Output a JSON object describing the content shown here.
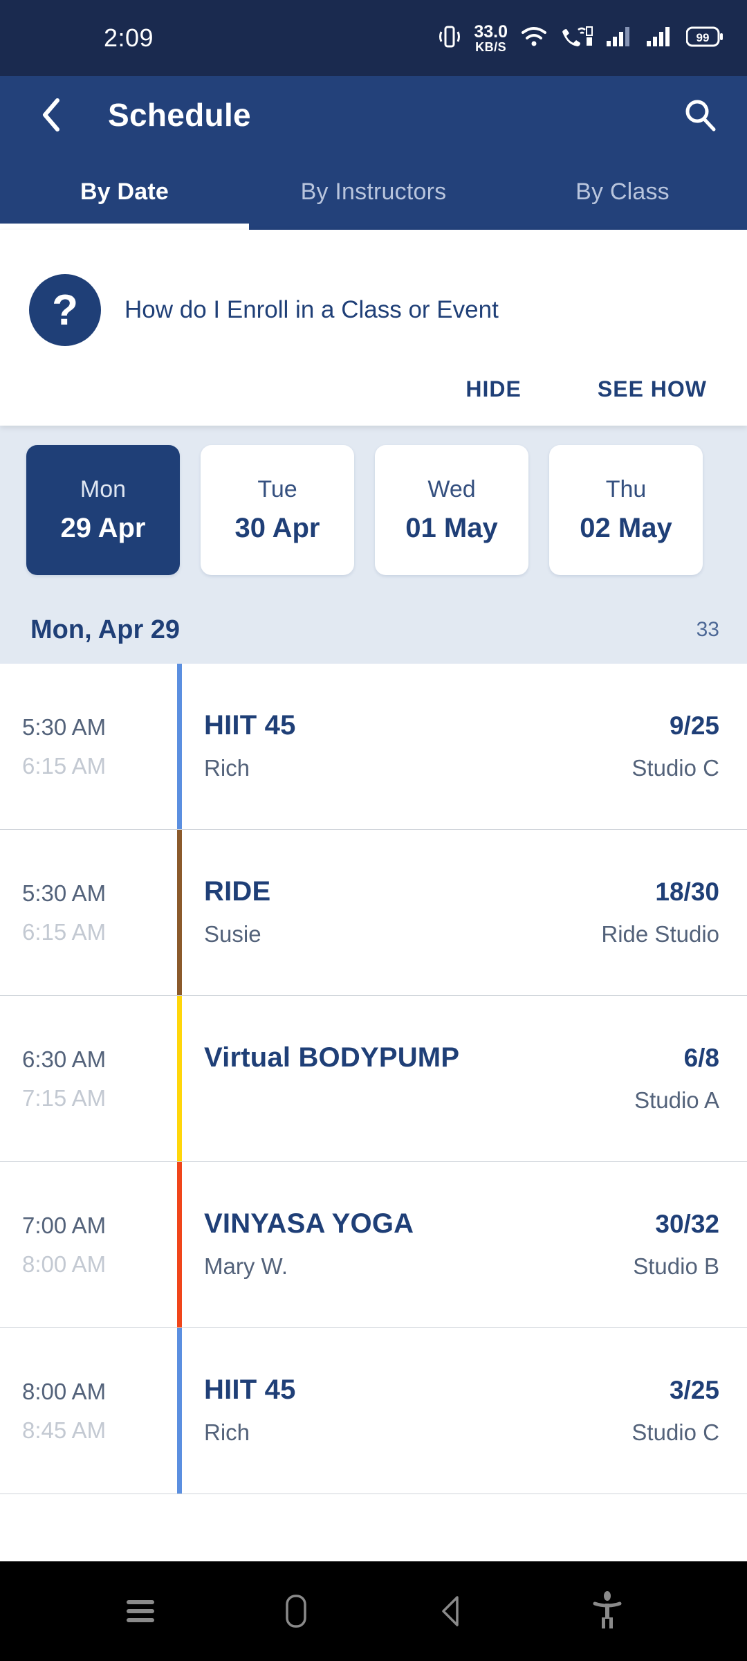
{
  "statusbar": {
    "time": "2:09",
    "net_speed_value": "33.0",
    "net_speed_unit": "KB/S",
    "battery": "99",
    "icons": [
      "vibrate-icon",
      "wifi-icon",
      "vowifi-sim2-icon",
      "signal-sim1-icon",
      "signal-sim2-icon",
      "battery-icon"
    ]
  },
  "header": {
    "title": "Schedule",
    "back_icon": "chevron-left-icon",
    "search_icon": "search-icon",
    "tabs": [
      {
        "label": "By Date",
        "active": true
      },
      {
        "label": "By Instructors",
        "active": false
      },
      {
        "label": "By Class",
        "active": false
      }
    ]
  },
  "help": {
    "icon_glyph": "?",
    "question": "How do I Enroll in a Class or Event",
    "hide_label": "HIDE",
    "see_how_label": "SEE HOW"
  },
  "dates": [
    {
      "dow": "Mon",
      "date": "29 Apr",
      "selected": true
    },
    {
      "dow": "Tue",
      "date": "30 Apr",
      "selected": false
    },
    {
      "dow": "Wed",
      "date": "01 May",
      "selected": false
    },
    {
      "dow": "Thu",
      "date": "02 May",
      "selected": false
    }
  ],
  "day_header": {
    "title": "Mon, Apr 29",
    "count": "33"
  },
  "classes": [
    {
      "start": "5:30 AM",
      "end": "6:15 AM",
      "name": "HIIT 45",
      "instructor": "Rich",
      "capacity": "9/25",
      "room": "Studio C",
      "accent": "#5b8fe0"
    },
    {
      "start": "5:30 AM",
      "end": "6:15 AM",
      "name": "RIDE",
      "instructor": "Susie",
      "capacity": "18/30",
      "room": "Ride Studio",
      "accent": "#8b5a2b"
    },
    {
      "start": "6:30 AM",
      "end": "7:15 AM",
      "name": "Virtual BODYPUMP",
      "instructor": "",
      "capacity": "6/8",
      "room": "Studio A",
      "accent": "#ffd60a"
    },
    {
      "start": "7:00 AM",
      "end": "8:00 AM",
      "name": "VINYASA YOGA",
      "instructor": "Mary W.",
      "capacity": "30/32",
      "room": "Studio B",
      "accent": "#f0451a"
    },
    {
      "start": "8:00 AM",
      "end": "8:45 AM",
      "name": "HIIT 45",
      "instructor": "Rich",
      "capacity": "3/25",
      "room": "Studio C",
      "accent": "#5b8fe0"
    }
  ],
  "navbar": {
    "items": [
      "recents-icon",
      "home-icon",
      "back-icon",
      "accessibility-icon"
    ]
  },
  "colors": {
    "statusbar_bg": "#1a2a4f",
    "header_bg": "#23417a",
    "navy": "#1f3f77",
    "date_strip_bg": "#e2e9f2"
  }
}
